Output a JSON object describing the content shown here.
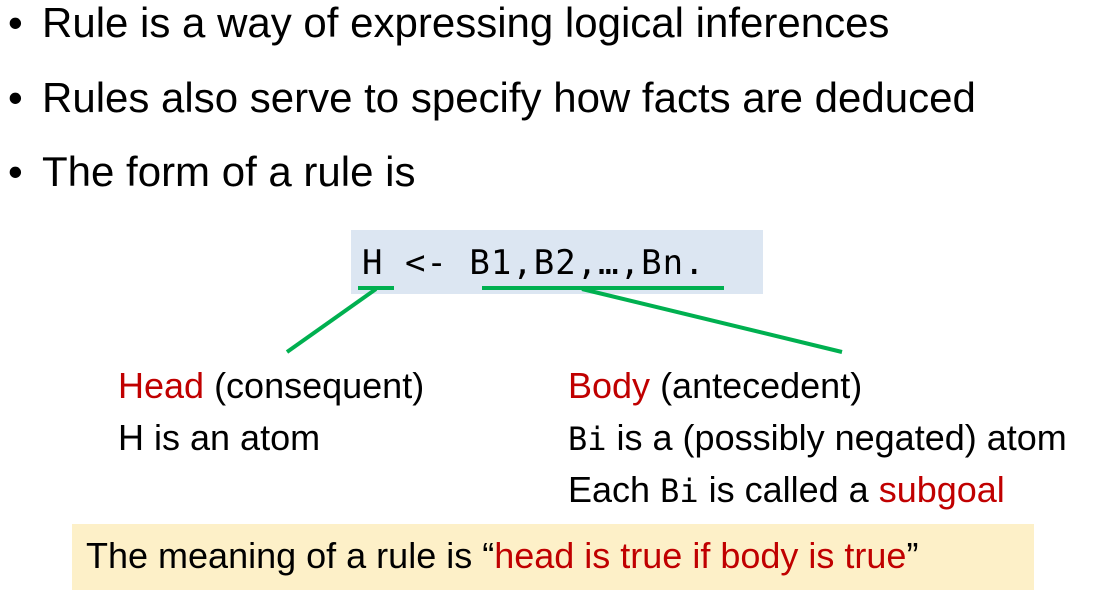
{
  "bullets": [
    "Rule is a way of expressing logical inferences",
    "Rules also serve to specify how facts are deduced",
    "The form of a rule is"
  ],
  "bullet_glyph": "•",
  "rule": "H <- B1,B2,…,Bn.",
  "head": {
    "title": "Head",
    "title_note": " (consequent)",
    "desc": "H is an atom"
  },
  "body": {
    "title": "Body",
    "title_note": " (antecedent)",
    "desc1_code": "Bi",
    "desc1_text": " is a (possibly negated) atom",
    "desc2_pre": "Each ",
    "desc2_code": "Bi",
    "desc2_mid": " is called a ",
    "desc2_red": "subgoal"
  },
  "meaning": {
    "pre": "The meaning of a rule is “",
    "red": "head is true if body is true",
    "post": "”"
  },
  "colors": {
    "accent_red": "#c00000",
    "connector_green": "#00b050",
    "rule_box_bg": "#dce6f2",
    "meaning_box_bg": "#fdf0c8"
  }
}
